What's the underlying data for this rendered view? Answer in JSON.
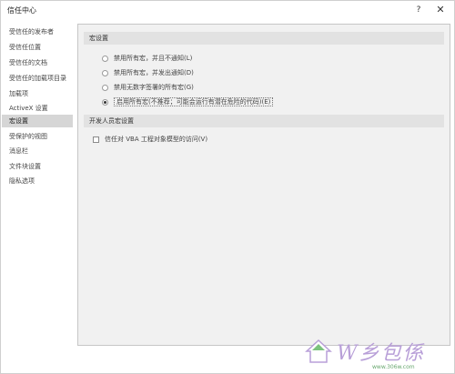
{
  "window": {
    "title": "信任中心",
    "help_label": "?",
    "close_label": "✕"
  },
  "sidebar": {
    "items": [
      {
        "label": "受信任的发布者",
        "selected": false
      },
      {
        "label": "受信任位置",
        "selected": false
      },
      {
        "label": "受信任的文档",
        "selected": false
      },
      {
        "label": "受信任的加载项目录",
        "selected": false
      },
      {
        "label": "加载项",
        "selected": false
      },
      {
        "label": "ActiveX 设置",
        "selected": false
      },
      {
        "label": "宏设置",
        "selected": true
      },
      {
        "label": "受保护的视图",
        "selected": false
      },
      {
        "label": "消息栏",
        "selected": false
      },
      {
        "label": "文件块设置",
        "selected": false
      },
      {
        "label": "隐私选项",
        "selected": false
      }
    ]
  },
  "macro_settings": {
    "header": "宏设置",
    "options": [
      {
        "label": "禁用所有宏，并且不通知(L)",
        "checked": false
      },
      {
        "label": "禁用所有宏，并发出通知(D)",
        "checked": false
      },
      {
        "label": "禁用无数字签署的所有宏(G)",
        "checked": false
      },
      {
        "label": "启用所有宏(不推荐；可能会运行有潜在危险的代码)(E)",
        "checked": true
      }
    ]
  },
  "developer_settings": {
    "header": "开发人员宏设置",
    "vba_access_label": "信任对 VBA 工程对象模型的访问(V)",
    "vba_access_checked": false
  },
  "watermark": {
    "url": "www.306w.com"
  },
  "colors": {
    "selected_bg": "#d6d6d6",
    "content_bg": "#f1f1f1",
    "header_bg": "#e2e2e2",
    "watermark": "#b89fd8"
  }
}
